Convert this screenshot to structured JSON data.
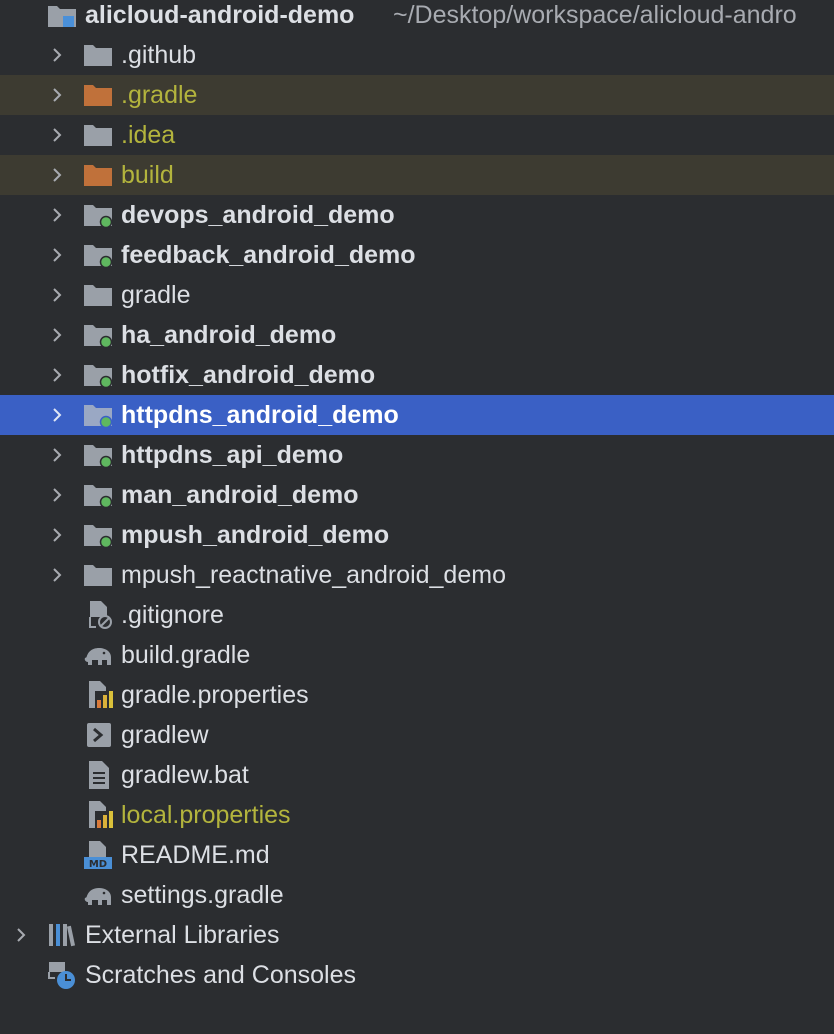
{
  "root": {
    "name": "alicloud-android-demo",
    "path": "~/Desktop/workspace/alicloud-andro"
  },
  "items": [
    {
      "label": ".github"
    },
    {
      "label": ".gradle"
    },
    {
      "label": ".idea"
    },
    {
      "label": "build"
    },
    {
      "label": "devops_android_demo"
    },
    {
      "label": "feedback_android_demo"
    },
    {
      "label": "gradle"
    },
    {
      "label": "ha_android_demo"
    },
    {
      "label": "hotfix_android_demo"
    },
    {
      "label": "httpdns_android_demo"
    },
    {
      "label": "httpdns_api_demo"
    },
    {
      "label": "man_android_demo"
    },
    {
      "label": "mpush_android_demo"
    },
    {
      "label": "mpush_reactnative_android_demo"
    },
    {
      "label": ".gitignore"
    },
    {
      "label": "build.gradle"
    },
    {
      "label": "gradle.properties"
    },
    {
      "label": "gradlew"
    },
    {
      "label": "gradlew.bat"
    },
    {
      "label": "local.properties"
    },
    {
      "label": "README.md"
    },
    {
      "label": "settings.gradle"
    }
  ],
  "external_libraries": {
    "label": "External Libraries"
  },
  "scratches": {
    "label": "Scratches and Consoles"
  },
  "colors": {
    "background": "#2b2d30",
    "selection": "#3a60c5",
    "ignored_row": "#3d3b31",
    "ignored_text": "#b3b43d",
    "module_dot": "#5fb85f",
    "folder_gray": "#9aa0a8",
    "folder_orange": "#c0713a"
  }
}
